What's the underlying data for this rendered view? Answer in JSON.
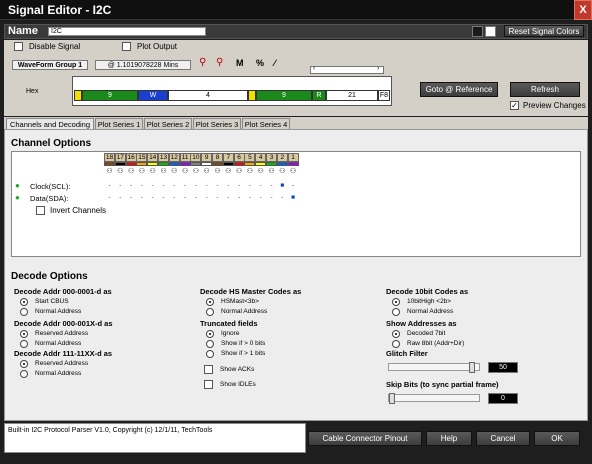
{
  "window": {
    "title": "Signal Editor - I2C",
    "close": "X"
  },
  "name_bar": {
    "label": "Name",
    "value": "I2C",
    "reset_colors": "Reset Signal Colors",
    "swatches": [
      "#1a1a1a",
      "#ffffff"
    ]
  },
  "options": {
    "disable_signal": "Disable Signal",
    "plot_output": "Plot Output"
  },
  "waveform": {
    "group": "WaveForm Group 1",
    "time": "@ 1.1019078228 Mins",
    "row_label": "Hex",
    "segments": [
      {
        "label": "",
        "color": "#f2e000"
      },
      {
        "label": "9",
        "color": "#1a8a1a"
      },
      {
        "label": "W",
        "color": "#1a3fd0"
      },
      {
        "label": "4",
        "color": "#ffffff"
      },
      {
        "label": "",
        "color": "#f2e000"
      },
      {
        "label": "9",
        "color": "#1a8a1a"
      },
      {
        "label": "R",
        "color": "#1a8a1a"
      },
      {
        "label": "21",
        "color": "#ffffff"
      },
      {
        "label": "F8",
        "color": "#ffffff"
      }
    ]
  },
  "buttons": {
    "goto_ref": "Goto @ Reference",
    "refresh": "Refresh",
    "preview": "Preview Changes"
  },
  "tabs": [
    "Channels and Decoding",
    "Plot Series 1",
    "Plot Series 2",
    "Plot Series 3",
    "Plot Series 4"
  ],
  "channels": {
    "title": "Channel Options",
    "numbers": [
      "18",
      "17",
      "16",
      "15",
      "14",
      "13",
      "12",
      "11",
      "10",
      "9",
      "8",
      "7",
      "6",
      "5",
      "4",
      "3",
      "2",
      "1"
    ],
    "colors": [
      "#8B4513",
      "#000000",
      "#ff0000",
      "#ffa500",
      "#ffff00",
      "#00c000",
      "#0060ff",
      "#a000ff",
      "#808080",
      "#ffffff",
      "#8B4513",
      "#000000",
      "#ff0000",
      "#ffa500",
      "#ffff00",
      "#00c000",
      "#0060ff",
      "#a000ff"
    ],
    "rows": [
      {
        "name": "Clock(SCL):",
        "values": [
          "-",
          "-",
          "-",
          "-",
          "-",
          "-",
          "-",
          "-",
          "-",
          "-",
          "-",
          "-",
          "-",
          "-",
          "-",
          "-",
          "■",
          "-"
        ]
      },
      {
        "name": "Data(SDA):",
        "values": [
          "-",
          "-",
          "-",
          "-",
          "-",
          "-",
          "-",
          "-",
          "-",
          "-",
          "-",
          "-",
          "-",
          "-",
          "-",
          "-",
          "-",
          "■"
        ]
      }
    ],
    "invert": "Invert Channels"
  },
  "decode": {
    "title": "Decode Options",
    "groups": [
      {
        "title": "Decode Addr 000-0001-d as",
        "options": [
          "Start CBUS",
          "Normal Address"
        ],
        "selected": 0
      },
      {
        "title": "Decode Addr 000-001X-d as",
        "options": [
          "Reserved Address",
          "Normal Address"
        ],
        "selected": 0
      },
      {
        "title": "Decode Addr 111-11XX-d as",
        "options": [
          "Reserved Address",
          "Normal Address"
        ],
        "selected": 0
      },
      {
        "title": "Decode HS Master Codes as",
        "options": [
          "HSMast<3b>",
          "Normal Address"
        ],
        "selected": 0
      },
      {
        "title": "Truncated fields",
        "options": [
          "Ignore",
          "Show if > 0 bits",
          "Show if > 1 bits"
        ],
        "selected": 0
      },
      {
        "title": "Decode 10bit Codes as",
        "options": [
          "10bitHigh <2b>",
          "Normal Address"
        ],
        "selected": 0
      },
      {
        "title": "Show Addresses as",
        "options": [
          "Decoded 7bit",
          "Raw 8bit (Addr+Dir)"
        ],
        "selected": 0
      }
    ],
    "show_acks": "Show ACKs",
    "show_idles": "Show IDLEs",
    "glitch_title": "Glitch Filter",
    "glitch_value": "50",
    "glitch_fraction": 0.95,
    "skip_title": "Skip Bits (to sync partial frame)",
    "skip_value": "0",
    "skip_fraction": 0.0
  },
  "footer": {
    "status": "Built-in I2C Protocol Parser V1.0,  Copyright (c) 12/1/11, TechTools",
    "pinout": "Cable Connector Pinout",
    "help": "Help",
    "cancel": "Cancel",
    "ok": "OK"
  }
}
